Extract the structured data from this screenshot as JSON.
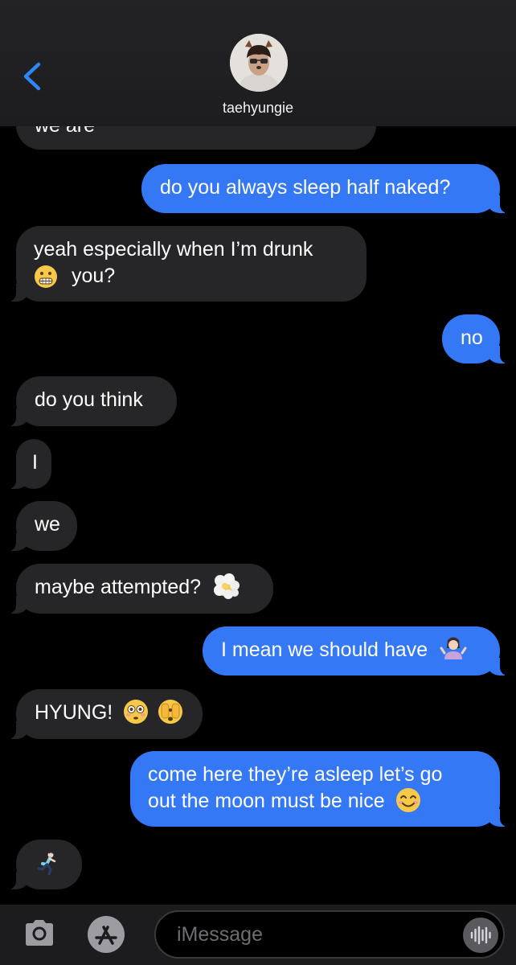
{
  "header": {
    "contact_name": "taehyungie"
  },
  "messages": {
    "m0": "we are",
    "m1": "do you always sleep half naked?",
    "m2_line1": "yeah especially when I’m drunk",
    "m2_line2": "you?",
    "m3": "no",
    "m4": "do you think",
    "m5": "I",
    "m6": "we",
    "m7": "maybe attempted?",
    "m8": "I mean we should have",
    "m9": "HYUNG!",
    "m10_line1": "come here they’re asleep let’s go",
    "m10_line2": "out the moon must be nice"
  },
  "composer": {
    "placeholder": "iMessage"
  },
  "colors": {
    "outgoing": "#3478f6",
    "incoming": "#262628",
    "background": "#000000"
  },
  "icons": {
    "back": "chevron-left-icon",
    "camera": "camera-icon",
    "apps": "app-store-icon",
    "audio": "audio-waveform-icon",
    "emojis": [
      "grimacing-face",
      "face-in-clouds",
      "woman-shrugging",
      "flushed-face",
      "face-with-peeking-eye",
      "smiling-face-with-smiling-eyes",
      "woman-running"
    ]
  }
}
